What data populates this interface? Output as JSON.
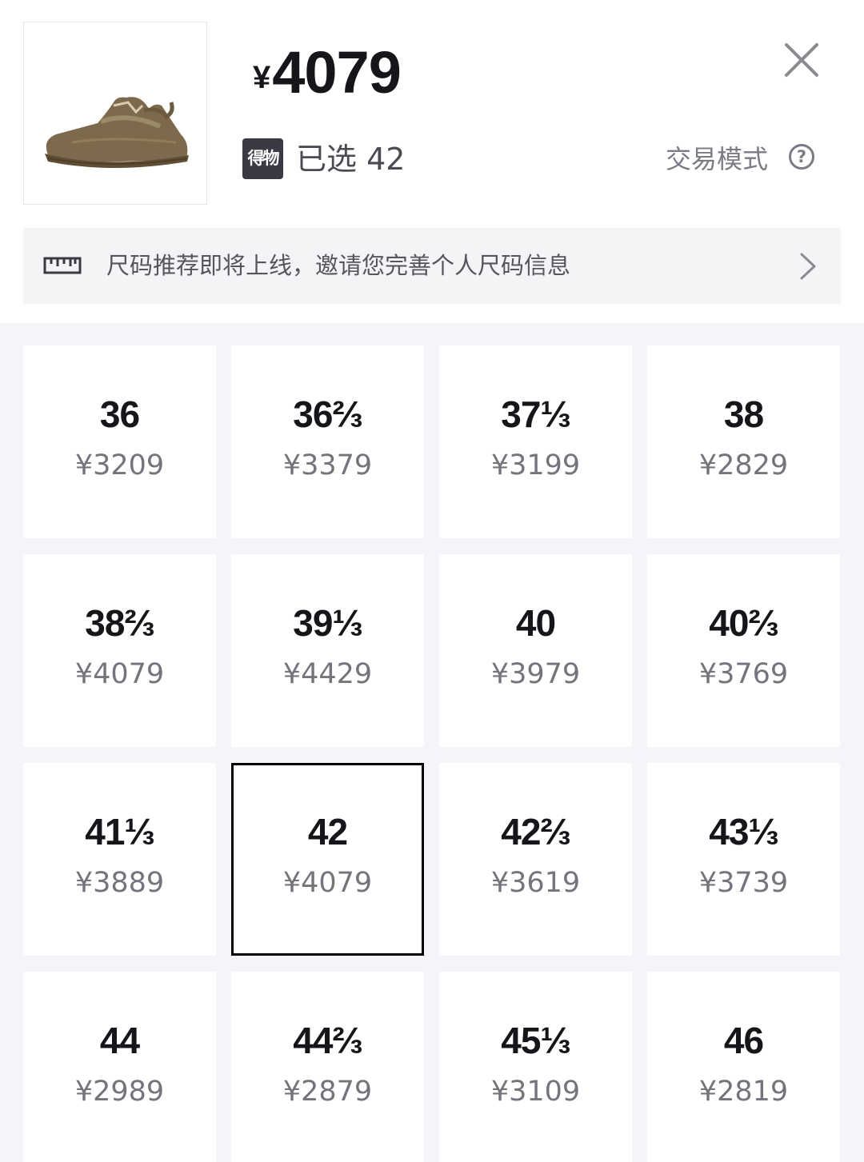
{
  "header": {
    "currency": "¥",
    "price": "4079",
    "badge": "得物",
    "selected_label": "已选 42",
    "mode_label": "交易模式",
    "help_glyph": "?"
  },
  "banner": {
    "text": "尺码推荐即将上线，邀请您完善个人尺码信息"
  },
  "icons": {
    "close": "close-icon",
    "help": "question-circle-icon",
    "ruler": "ruler-icon",
    "chevron": "chevron-right-icon",
    "product": "sneaker-image"
  },
  "colors": {
    "text": "#16161a",
    "muted": "#74747c",
    "badge_bg": "#3a3a44",
    "grid_bg": "#f5f5f9",
    "selected_border": "#000000"
  },
  "sizes": [
    {
      "size": "36",
      "price": "¥3209"
    },
    {
      "size": "36⅔",
      "price": "¥3379"
    },
    {
      "size": "37⅓",
      "price": "¥3199"
    },
    {
      "size": "38",
      "price": "¥2829"
    },
    {
      "size": "38⅔",
      "price": "¥4079"
    },
    {
      "size": "39⅓",
      "price": "¥4429"
    },
    {
      "size": "40",
      "price": "¥3979"
    },
    {
      "size": "40⅔",
      "price": "¥3769"
    },
    {
      "size": "41⅓",
      "price": "¥3889"
    },
    {
      "size": "42",
      "price": "¥4079",
      "selected": true
    },
    {
      "size": "42⅔",
      "price": "¥3619"
    },
    {
      "size": "43⅓",
      "price": "¥3739"
    },
    {
      "size": "44",
      "price": "¥2989"
    },
    {
      "size": "44⅔",
      "price": "¥2879"
    },
    {
      "size": "45⅓",
      "price": "¥3109"
    },
    {
      "size": "46",
      "price": "¥2819"
    }
  ]
}
